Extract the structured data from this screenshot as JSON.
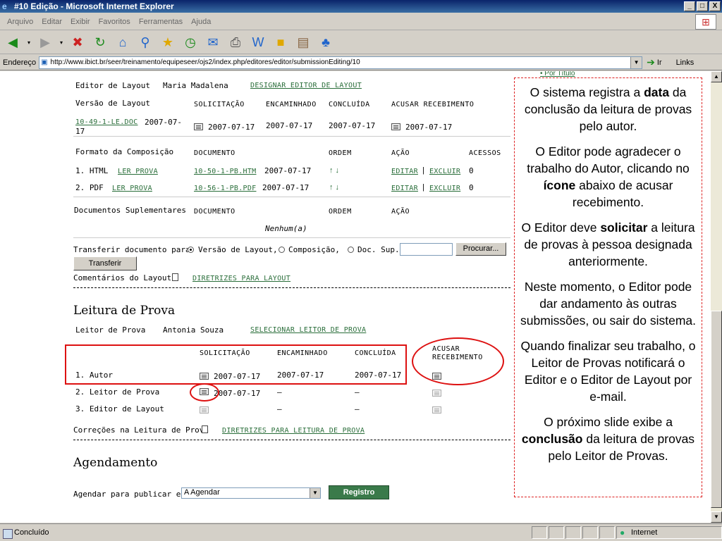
{
  "window": {
    "title": "#10 Edição - Microsoft Internet Explorer",
    "btn_min": "_",
    "btn_max": "□",
    "btn_close": "X"
  },
  "menu": [
    "Arquivo",
    "Editar",
    "Exibir",
    "Favoritos",
    "Ferramentas",
    "Ajuda"
  ],
  "address": {
    "label": "Endereço",
    "url": "http://www.ibict.br/seer/treinamento/equipeseer/ojs2/index.php/editores/editor/submissionEditing/10",
    "go": "Ir",
    "links": "Links"
  },
  "status": {
    "text": "Concluído",
    "zone": "Internet"
  },
  "colors": {
    "link": "#2a6e3a",
    "annotation": "#dd1111",
    "titlebar": "#0a246a"
  },
  "page": {
    "top_link": "Por Título",
    "layout": {
      "editor_label": "Editor de Layout",
      "editor_name": "Maria Madalena",
      "assign_link": "DESIGNAR EDITOR DE LAYOUT",
      "version_label": "Versão de Layout",
      "headers": [
        "SOLICITAÇÃO",
        "ENCAMINHADO",
        "CONCLUÍDA",
        "ACUSAR RECEBIMENTO"
      ],
      "version_file": "10-49-1-LE.DOC",
      "version_date_a": "2007-07-",
      "version_date_b": "17",
      "requested": "2007-07-17",
      "sent": "2007-07-17",
      "completed": "2007-07-17",
      "acknowledged": "2007-07-17",
      "format_label": "Formato da Composição",
      "format_headers": [
        "DOCUMENTO",
        "ORDEM",
        "AÇÃO",
        "ACESSOS"
      ],
      "formats": [
        {
          "num": "1. HTML",
          "read": "LER PROVA",
          "doc": "10-50-1-PB.HTM",
          "date": "2007-07-17",
          "order": "↑ ↓",
          "edit": "EDITAR",
          "sep": "|",
          "delete": "EXCLUIR",
          "access": "0"
        },
        {
          "num": "2. PDF",
          "read": "LER PROVA",
          "doc": "10-56-1-PB.PDF",
          "date": "2007-07-17",
          "order": "↑ ↓",
          "edit": "EDITAR",
          "sep": "|",
          "delete": "EXCLUIR",
          "access": "0"
        }
      ],
      "supp_label": "Documentos Suplementares",
      "supp_headers": [
        "DOCUMENTO",
        "ORDEM",
        "AÇÃO"
      ],
      "supp_none": "Nenhum(a)",
      "transfer_label": "Transferir documento para",
      "radio_1": "Versão de Layout,",
      "radio_2": "Composição,",
      "radio_3": "Doc. Sup.",
      "browse": "Procurar...",
      "transfer_btn": "Transferir",
      "comments_label": "Comentários do Layout",
      "guidelines_link": "DIRETRIZES PARA LAYOUT"
    },
    "proof": {
      "title": "Leitura de Prova",
      "reader_label": "Leitor de Prova",
      "reader_name": "Antonia Souza",
      "select_link": "SELECIONAR LEITOR DE PROVA",
      "headers": [
        "SOLICITAÇÃO",
        "ENCAMINHADO",
        "CONCLUÍDA",
        "ACUSAR RECEBIMENTO"
      ],
      "rows": [
        {
          "label": "1. Autor",
          "requested": "2007-07-17",
          "sent": "2007-07-17",
          "completed": "2007-07-17"
        },
        {
          "label": "2. Leitor de Prova",
          "requested": "2007-07-17",
          "sent": "—",
          "completed": "—"
        },
        {
          "label": "3. Editor de Layout",
          "requested": "",
          "sent": "—",
          "completed": "—"
        }
      ],
      "corrections_label": "Correções na Leitura de Prova",
      "guidelines_link": "DIRETRIZES PARA LEITURA DE PROVA"
    },
    "schedule": {
      "title": "Agendamento",
      "label": "Agendar para publicar em",
      "selected": "A Agendar",
      "button": "Registro"
    }
  },
  "note": {
    "p1": [
      "O sistema registra a ",
      "data",
      " da conclusão da leitura de provas pelo autor."
    ],
    "p2": [
      "O Editor pode agradecer o trabalho do Autor, clicando no ",
      "ícone",
      " abaixo de acusar recebimento."
    ],
    "p3": [
      "O Editor deve ",
      "solicitar",
      " a leitura de provas à pessoa designada anteriormente."
    ],
    "p4": "Neste momento, o Editor pode dar andamento às outras submissões, ou sair do sistema.",
    "p5": "Quando finalizar seu trabalho, o Leitor de Provas notificará o Editor e o Editor de Layout por e-mail.",
    "p6": [
      "O próximo slide exibe a ",
      "conclusão",
      " da leitura de provas pelo Leitor de Provas."
    ]
  }
}
